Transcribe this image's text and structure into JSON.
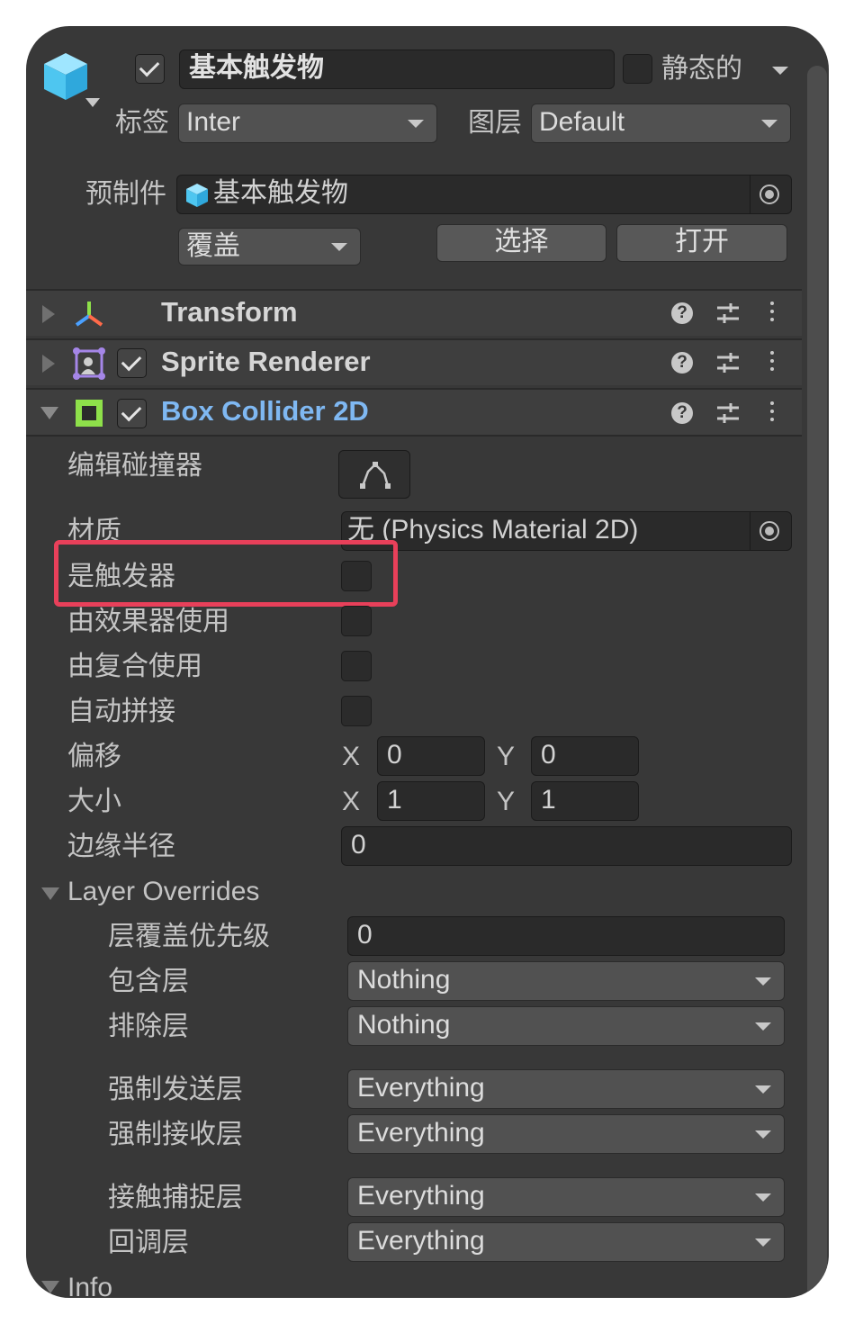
{
  "header": {
    "name_value": "基本触发物",
    "static_label": "静态的",
    "tag_label": "标签",
    "tag_value": "Inter",
    "layer_label": "图层",
    "layer_value": "Default"
  },
  "prefab": {
    "label": "预制件",
    "value": "基本触发物",
    "overrides_label": "覆盖",
    "select_label": "选择",
    "open_label": "打开"
  },
  "components": [
    {
      "title": "Transform"
    },
    {
      "title": "Sprite Renderer"
    },
    {
      "title": "Box Collider 2D"
    }
  ],
  "help_glyph": "?",
  "collider": {
    "edit_label": "编辑碰撞器",
    "material_label": "材质",
    "material_value": "无 (Physics Material 2D)",
    "is_trigger_label": "是触发器",
    "used_by_effector_label": "由效果器使用",
    "used_by_composite_label": "由复合使用",
    "auto_tiling_label": "自动拼接",
    "offset_label": "偏移",
    "offset_x": "0",
    "offset_y": "0",
    "size_label": "大小",
    "size_x": "1",
    "size_y": "1",
    "edge_radius_label": "边缘半径",
    "edge_radius_value": "0",
    "x_axis": "X",
    "y_axis": "Y"
  },
  "layer_overrides": {
    "title": "Layer Overrides",
    "priority_label": "层覆盖优先级",
    "priority_value": "0",
    "include_label": "包含层",
    "include_value": "Nothing",
    "exclude_label": "排除层",
    "exclude_value": "Nothing",
    "force_send_label": "强制发送层",
    "force_send_value": "Everything",
    "force_receive_label": "强制接收层",
    "force_receive_value": "Everything",
    "contact_capture_label": "接触捕捉层",
    "contact_capture_value": "Everything",
    "callback_label": "回调层",
    "callback_value": "Everything"
  },
  "info": {
    "title": "Info"
  },
  "colors": {
    "panel_bg": "#383838",
    "highlight_box": "#e8405a",
    "collider_title": "#7fb8f2",
    "collider_icon": "#8ee04a"
  }
}
